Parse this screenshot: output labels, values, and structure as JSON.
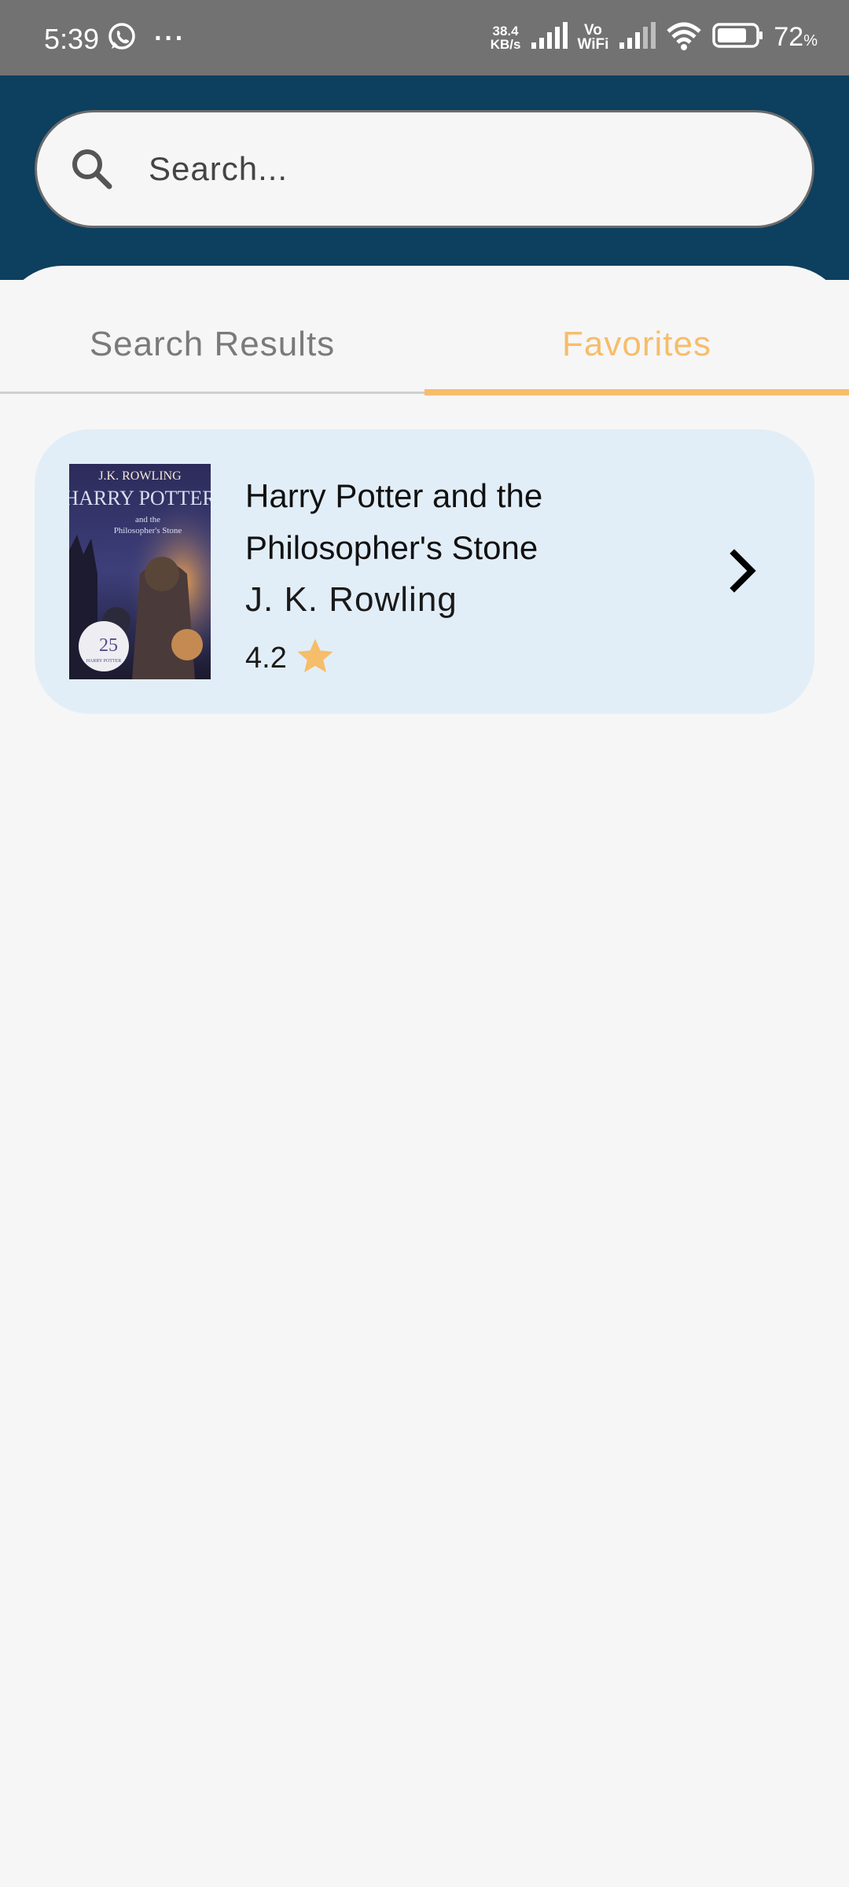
{
  "status_bar": {
    "time": "5:39",
    "more": "···",
    "net_speed_value": "38.4",
    "net_speed_unit": "KB/s",
    "vo_label": "Vo",
    "wifi_label": "WiFi",
    "battery_percent": "72",
    "battery_unit": "%",
    "battery_level": 0.72
  },
  "search": {
    "placeholder": "Search..."
  },
  "tabs": [
    {
      "label": "Search Results",
      "selected": false
    },
    {
      "label": "Favorites",
      "selected": true
    }
  ],
  "colors": {
    "header": "#0d3f5f",
    "accent": "#f6bd6a",
    "card": "#e2eef7",
    "background": "#f6f6f6"
  },
  "favorites": [
    {
      "title": "Harry Potter and the Philosopher's Stone",
      "author": "J. K. Rowling",
      "rating": "4.2",
      "cover_text": {
        "author": "J.K. ROWLING",
        "series": "HARRY POTTER",
        "sub1": "and the",
        "sub2": "Philosopher's Stone",
        "badge": "25",
        "badge_sub": "HARRY POTTER"
      }
    }
  ]
}
